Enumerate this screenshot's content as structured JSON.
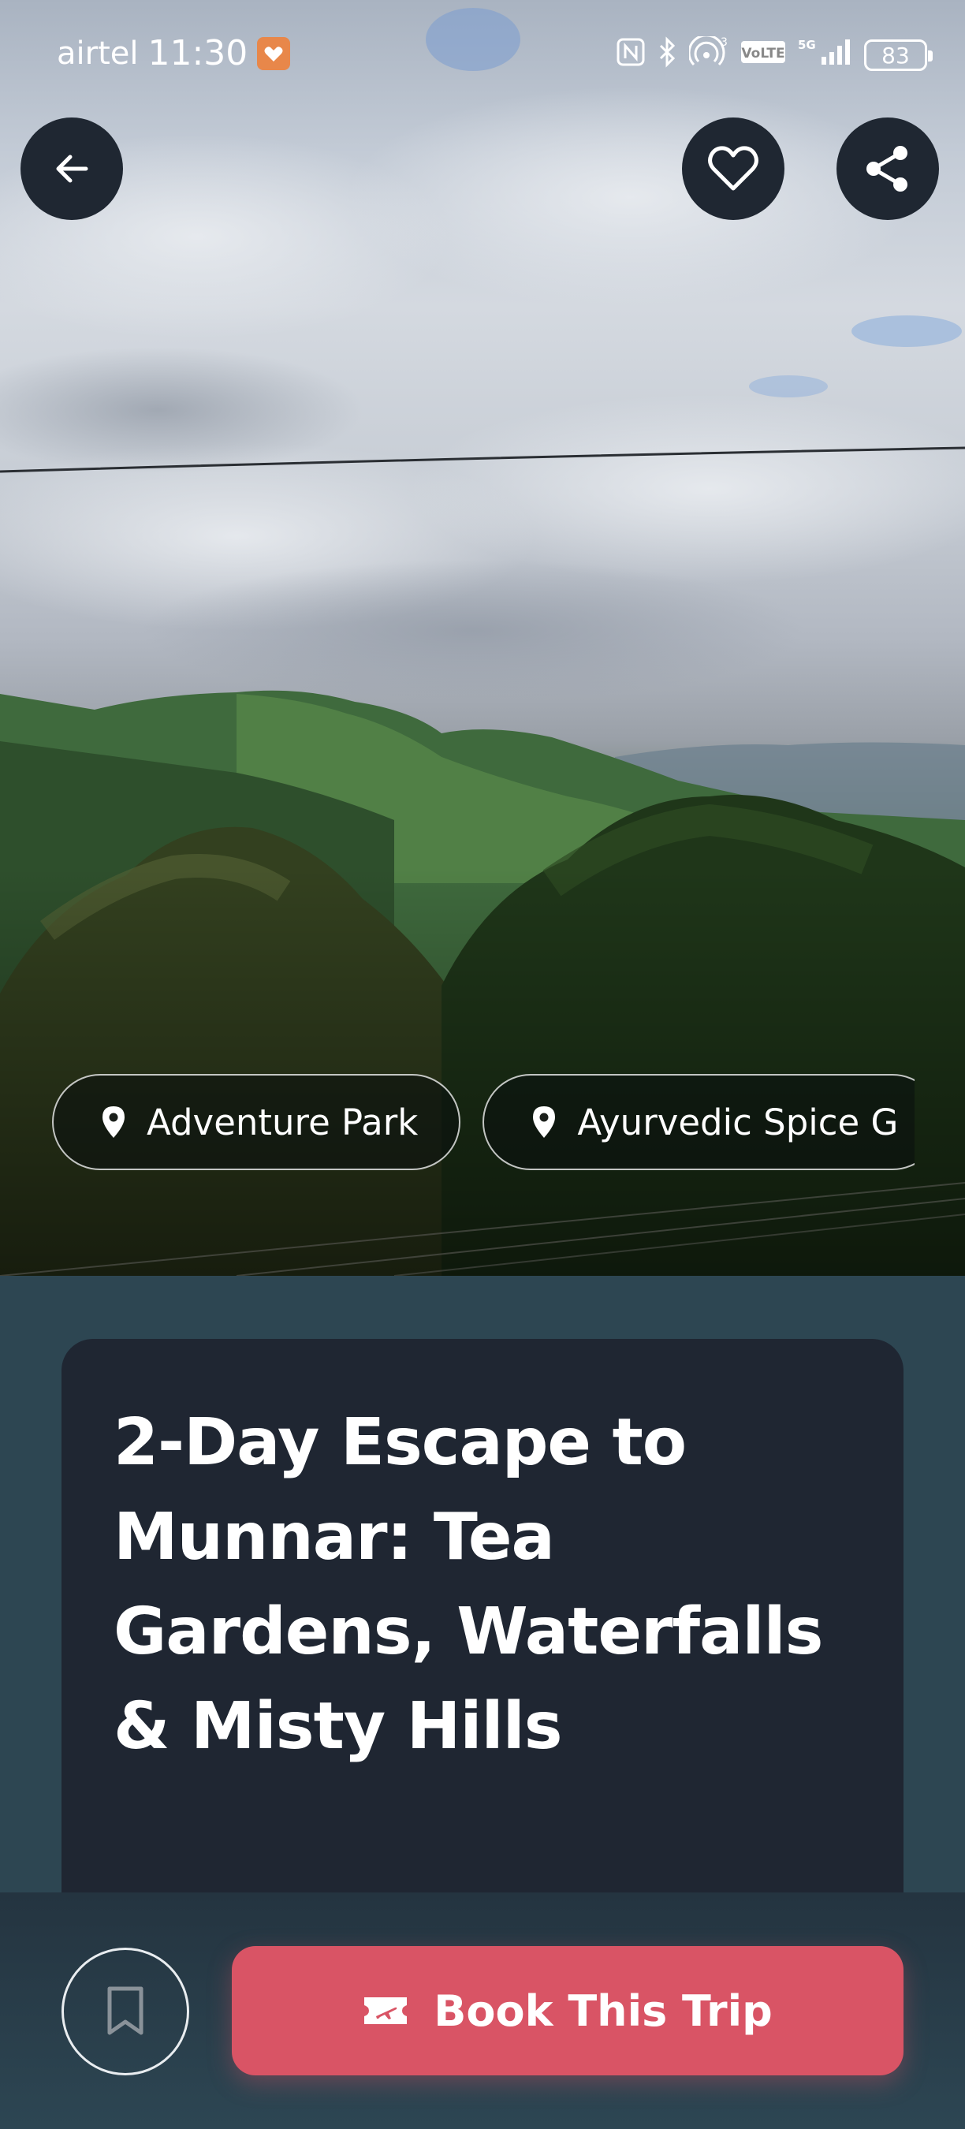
{
  "status_bar": {
    "carrier": "airtel",
    "time": "11:30",
    "network": "5G",
    "sim_count": "3",
    "volte": "VoLTE",
    "battery": "83"
  },
  "header": {
    "back_icon": "arrow-left-icon",
    "favorite_icon": "heart-icon",
    "share_icon": "share-icon"
  },
  "locations": [
    {
      "label": "Adventure Park",
      "icon": "map-pin-icon"
    },
    {
      "label": "Ayurvedic Spice G",
      "icon": "map-pin-icon"
    }
  ],
  "trip": {
    "title": "2-Day Escape to Munnar: Tea Gardens, Waterfalls & Misty Hills"
  },
  "actions": {
    "bookmark_icon": "bookmark-icon",
    "book_label": "Book This Trip",
    "book_icon": "ticket-plane-icon",
    "accent": "#d95465"
  },
  "colors": {
    "card_bg": "#1f2632",
    "page_bg": "#2d4652",
    "button_dark": "#1f2732"
  }
}
